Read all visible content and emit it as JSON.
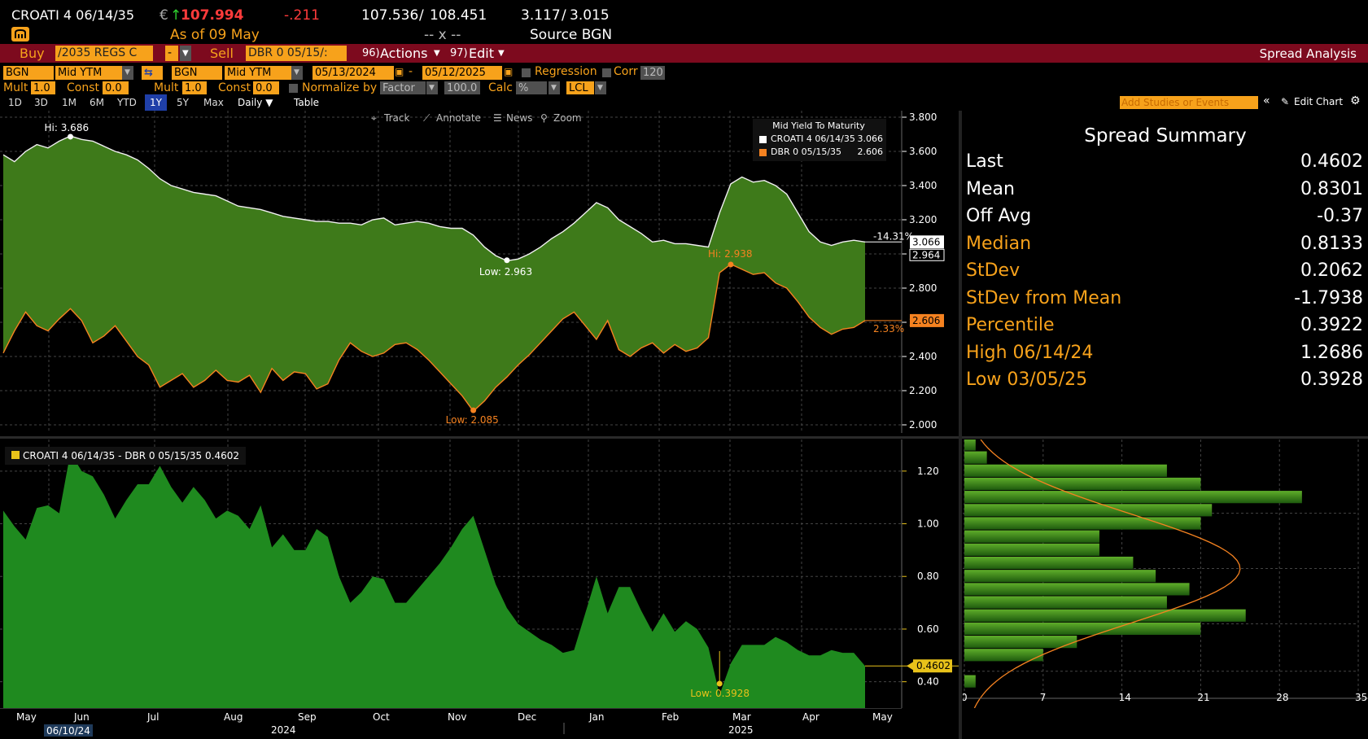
{
  "header": {
    "ticker": "CROATI 4 06/14/35",
    "currency_sign": "€",
    "up_arrow": "↑",
    "price": "107.994",
    "change": "-.211",
    "bid": "107.536",
    "ask": "108.451",
    "separator": "/",
    "yield_bid": "3.117",
    "yield_ask": "3.015",
    "as_of": "As of 09 May",
    "dashes": "-- x --",
    "source": "Source BGN",
    "logo_icon": "bloomberg-icon"
  },
  "toolbar": {
    "buy_label": "Buy",
    "buy_security": "/2035 REGS C",
    "buy_dash": "-",
    "sell_label": "Sell",
    "sell_security": "DBR 0 05/15/:",
    "actions_key": "96)",
    "actions_label": "Actions",
    "edit_key": "97)",
    "edit_label": "Edit",
    "right_title": "Spread Analysis"
  },
  "settings": {
    "source1": "BGN",
    "field1": "Mid YTM",
    "source2": "BGN",
    "field2": "Mid YTM",
    "start_date": "05/13/2024",
    "end_date": "05/12/2025",
    "regression_label": "Regression",
    "corr_label": "Corr",
    "corr_value": "120",
    "mult1_label": "Mult",
    "mult1_value": "1.0",
    "const1_label": "Const",
    "const1_value": "0.0",
    "mult2_label": "Mult",
    "mult2_value": "1.0",
    "const2_label": "Const",
    "const2_value": "0.0",
    "normalize_label": "Normalize by",
    "normalize_value": "Factor",
    "normalize_number": "100.0",
    "calc_label": "Calc",
    "calc_value": "%",
    "ccy_value": "LCL"
  },
  "ranges": {
    "items": [
      "1D",
      "3D",
      "1M",
      "6M",
      "YTD",
      "1Y",
      "5Y",
      "Max"
    ],
    "active": "1Y",
    "daily": "Daily",
    "table": "Table",
    "add_studies": "Add Studies or Events",
    "edit_chart": "Edit Chart"
  },
  "chart_tools": {
    "track": "Track",
    "annotate": "Annotate",
    "news": "News",
    "zoom": "Zoom"
  },
  "legend_top": {
    "title": "Mid Yield To Maturity",
    "series1": "CROATI 4 06/14/35",
    "series1_value": "3.066",
    "series2": "DBR 0 05/15/35",
    "series2_value": "2.606"
  },
  "legend_bottom": {
    "series": "CROATI 4 06/14/35 - DBR 0 05/15/35 0.4602"
  },
  "summary": {
    "title": "Spread Summary",
    "rows": [
      {
        "label": "Last",
        "value": "0.4602",
        "color": "#ffffff"
      },
      {
        "label": "Mean",
        "value": "0.8301",
        "color": "#ffffff"
      },
      {
        "label": "Off Avg",
        "value": "-0.37",
        "color": "#ffffff"
      },
      {
        "label": "Median",
        "value": "0.8133",
        "color": "#f7a21b"
      },
      {
        "label": "StDev",
        "value": "0.2062",
        "color": "#f7a21b"
      },
      {
        "label": "StDev from Mean",
        "value": "-1.7938",
        "color": "#f7a21b"
      },
      {
        "label": "Percentile",
        "value": "0.3922",
        "color": "#f7a21b"
      },
      {
        "label": "High 06/14/24",
        "value": "1.2686",
        "color": "#f7a21b"
      },
      {
        "label": "Low 03/05/25",
        "value": "0.3928",
        "color": "#f7a21b"
      }
    ]
  },
  "colors": {
    "accent": "#f7a21b",
    "red_bar": "#7d0a1e",
    "fill_green": "#3e7a1a",
    "spread_green": "#1f8a1f",
    "series2": "#f58220",
    "spread_line": "#e8c21a"
  },
  "chart_data": [
    {
      "type": "line",
      "title": "Mid Yield To Maturity",
      "series": [
        {
          "name": "CROATI 4 06/14/35",
          "values": [
            3.58,
            3.54,
            3.6,
            3.64,
            3.62,
            3.66,
            3.69,
            3.67,
            3.66,
            3.63,
            3.6,
            3.58,
            3.55,
            3.5,
            3.44,
            3.4,
            3.38,
            3.36,
            3.35,
            3.34,
            3.31,
            3.28,
            3.27,
            3.26,
            3.24,
            3.22,
            3.21,
            3.2,
            3.19,
            3.19,
            3.18,
            3.18,
            3.17,
            3.2,
            3.21,
            3.17,
            3.18,
            3.19,
            3.18,
            3.16,
            3.15,
            3.15,
            3.11,
            3.04,
            2.99,
            2.96,
            2.97,
            3.0,
            3.04,
            3.09,
            3.13,
            3.18,
            3.24,
            3.3,
            3.27,
            3.2,
            3.16,
            3.12,
            3.07,
            3.08,
            3.06,
            3.06,
            3.05,
            3.04,
            3.24,
            3.41,
            3.45,
            3.42,
            3.43,
            3.4,
            3.35,
            3.24,
            3.13,
            3.07,
            3.05,
            3.07,
            3.08,
            3.07
          ]
        },
        {
          "name": "DBR 0 05/15/35",
          "values": [
            2.42,
            2.55,
            2.66,
            2.58,
            2.55,
            2.62,
            2.68,
            2.61,
            2.48,
            2.52,
            2.58,
            2.49,
            2.4,
            2.35,
            2.22,
            2.26,
            2.3,
            2.22,
            2.26,
            2.32,
            2.26,
            2.25,
            2.29,
            2.19,
            2.33,
            2.26,
            2.31,
            2.3,
            2.21,
            2.24,
            2.38,
            2.48,
            2.43,
            2.4,
            2.42,
            2.47,
            2.48,
            2.44,
            2.38,
            2.31,
            2.24,
            2.17,
            2.08,
            2.14,
            2.22,
            2.28,
            2.35,
            2.41,
            2.48,
            2.55,
            2.62,
            2.66,
            2.58,
            2.5,
            2.61,
            2.44,
            2.4,
            2.45,
            2.48,
            2.42,
            2.47,
            2.43,
            2.45,
            2.51,
            2.89,
            2.94,
            2.91,
            2.88,
            2.89,
            2.83,
            2.8,
            2.72,
            2.63,
            2.57,
            2.53,
            2.56,
            2.57,
            2.61
          ]
        }
      ],
      "x_start": "05/13/2024",
      "x_end": "05/12/2025",
      "ylim": [
        2.0,
        3.8
      ],
      "yticks": [
        "2.000",
        "2.200",
        "2.400",
        "2.600",
        "2.800",
        "3.000",
        "3.200",
        "3.400",
        "3.600",
        "3.800"
      ],
      "annotations": [
        {
          "text": "Hi: 3.686",
          "x": 6,
          "y": 3.686
        },
        {
          "text": "Low: 2.963",
          "x": 45,
          "y": 2.963
        },
        {
          "text": "Hi: 2.938",
          "x": 65,
          "y": 2.938
        },
        {
          "text": "Low: 2.085",
          "x": 42,
          "y": 2.085
        }
      ],
      "right_labels": {
        "s1_pct": "-14.31%",
        "s1_last": "3.066",
        "s1_prev": "2.964",
        "s2_pct": "2.33%",
        "s2_last": "2.606"
      }
    },
    {
      "type": "area",
      "title": "CROATI 4 06/14/35 - DBR 0 05/15/35",
      "series": [
        {
          "name": "CROATI 4 06/14/35 - DBR 0 05/15/35",
          "values": [
            1.05,
            0.99,
            0.94,
            1.06,
            1.07,
            1.04,
            1.27,
            1.2,
            1.18,
            1.11,
            1.02,
            1.09,
            1.15,
            1.15,
            1.22,
            1.14,
            1.08,
            1.14,
            1.09,
            1.02,
            1.05,
            1.03,
            0.98,
            1.07,
            0.91,
            0.96,
            0.9,
            0.9,
            0.98,
            0.95,
            0.8,
            0.7,
            0.74,
            0.8,
            0.79,
            0.7,
            0.7,
            0.75,
            0.8,
            0.85,
            0.91,
            0.98,
            1.03,
            0.9,
            0.77,
            0.68,
            0.62,
            0.59,
            0.56,
            0.54,
            0.51,
            0.52,
            0.66,
            0.8,
            0.66,
            0.76,
            0.76,
            0.67,
            0.59,
            0.66,
            0.59,
            0.63,
            0.6,
            0.53,
            0.35,
            0.47,
            0.54,
            0.54,
            0.54,
            0.57,
            0.55,
            0.52,
            0.5,
            0.5,
            0.52,
            0.51,
            0.51,
            0.46
          ]
        }
      ],
      "ylim": [
        0.3,
        1.32
      ],
      "yticks": [
        "0.40",
        "0.60",
        "0.80",
        "1.00",
        "1.20"
      ],
      "annotations": [
        {
          "text": "Low: 0.3928",
          "x": 64,
          "y": 0.3928
        }
      ],
      "last_label": "0.4602",
      "x_months": [
        "May",
        "Jun",
        "Jul",
        "Aug",
        "Sep",
        "Oct",
        "Nov",
        "Dec",
        "Jan",
        "Feb",
        "Mar",
        "Apr",
        "May"
      ],
      "x_years": [
        "2024",
        "2025"
      ],
      "x_start_date": "06/10/24"
    },
    {
      "type": "bar",
      "title": "",
      "orientation": "horizontal",
      "bins": [
        0.4,
        0.45,
        0.5,
        0.55,
        0.6,
        0.65,
        0.7,
        0.75,
        0.8,
        0.85,
        0.9,
        0.95,
        1.0,
        1.05,
        1.1,
        1.15,
        1.2,
        1.25,
        1.3
      ],
      "counts": [
        1,
        0,
        7,
        10,
        21,
        25,
        18,
        20,
        17,
        15,
        12,
        12,
        21,
        22,
        30,
        21,
        18,
        2,
        1
      ],
      "normal_fit": {
        "mean": 0.8301,
        "stdev": 0.2062
      },
      "xlim": [
        0,
        35
      ],
      "xticks": [
        "0",
        "7",
        "14",
        "21",
        "28",
        "35"
      ]
    }
  ]
}
